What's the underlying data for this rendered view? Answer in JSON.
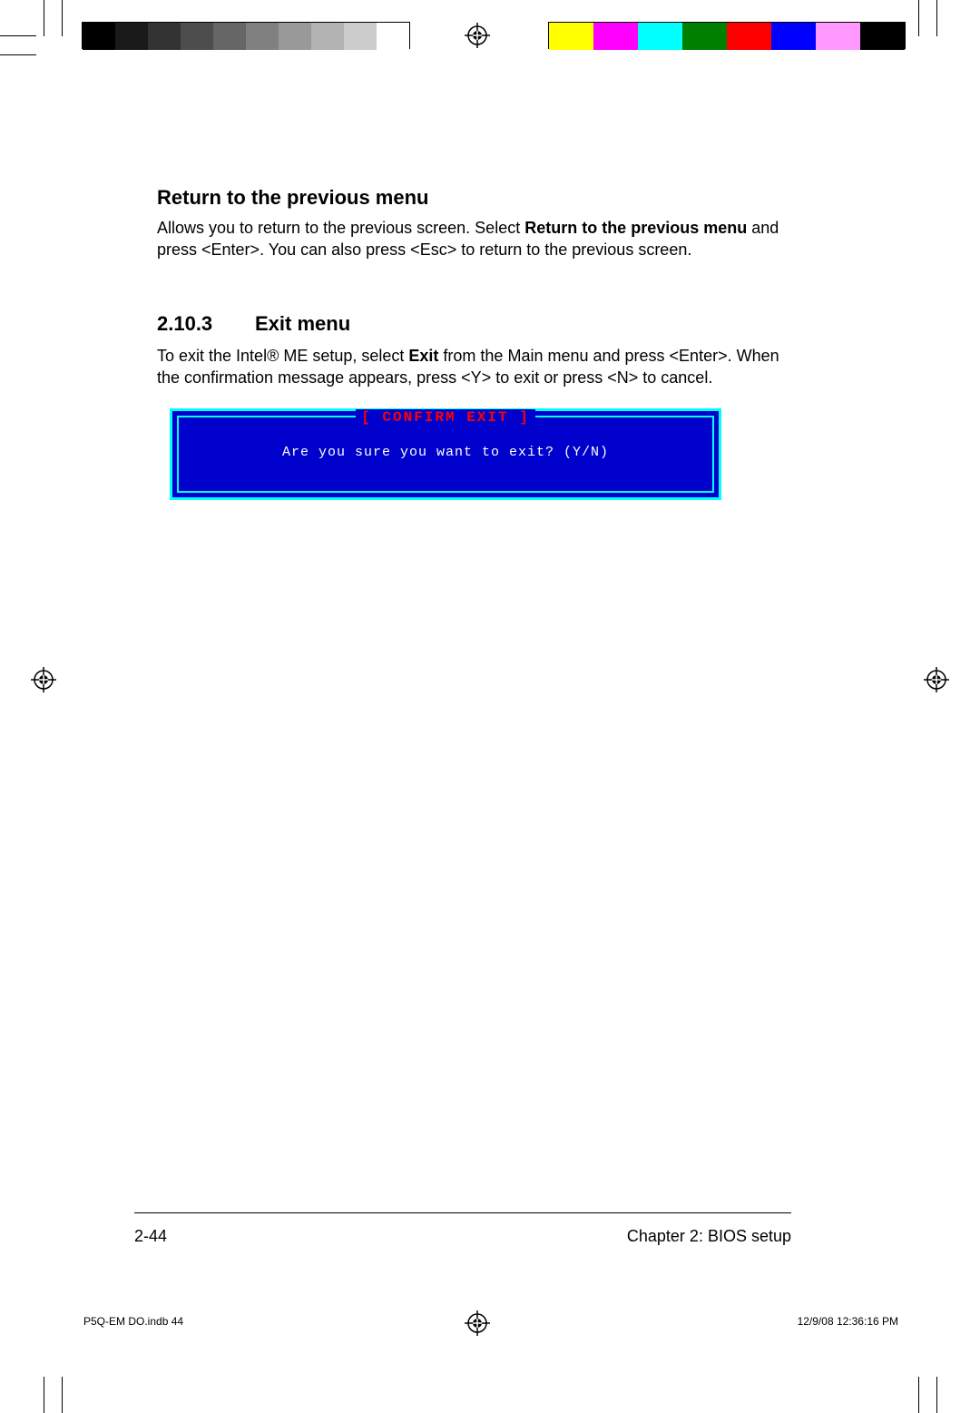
{
  "section1": {
    "title": "Return to the previous menu",
    "body_before": "Allows you to return to the previous screen. Select ",
    "body_bold": "Return to the previous menu",
    "body_after": " and press <Enter>. You can also press <Esc> to return to the previous screen."
  },
  "section2": {
    "number": "2.10.3",
    "title": "Exit menu",
    "body_before": "To exit the Intel® ME setup, select ",
    "body_bold": "Exit",
    "body_after": " from the Main menu and press <Enter>. When the confirmation message appears, press <Y> to exit or press <N> to cancel."
  },
  "dialog": {
    "title": "[  CONFIRM EXIT  ]",
    "message": "Are you sure you want to exit? (Y/N)"
  },
  "footer": {
    "page": "2-44",
    "chapter": "Chapter 2: BIOS setup"
  },
  "imprint": {
    "file": "P5Q-EM DO.indb   44",
    "timestamp": "12/9/08   12:36:16 PM"
  },
  "colorbar_grey": [
    "#000000",
    "#1a1a1a",
    "#333333",
    "#4d4d4d",
    "#666666",
    "#808080",
    "#999999",
    "#b3b3b3",
    "#cccccc",
    "#ffffff"
  ],
  "colorbar_color": [
    "#ffff00",
    "#ff00ff",
    "#00ffff",
    "#008000",
    "#ff0000",
    "#0000ff",
    "#ff99ff",
    "#000000"
  ]
}
